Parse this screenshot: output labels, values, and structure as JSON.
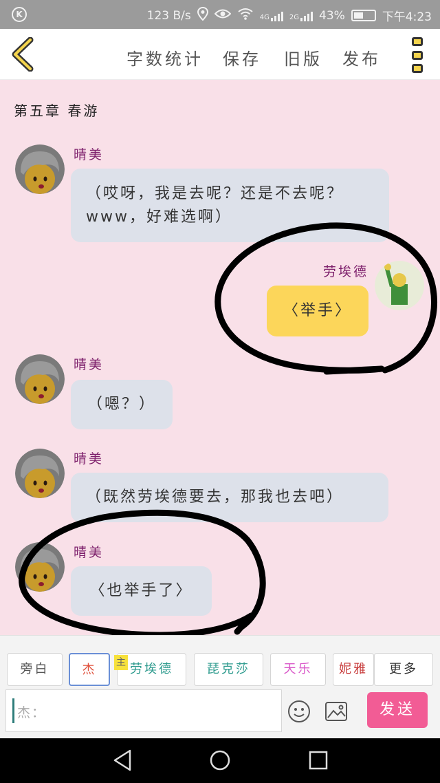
{
  "status_bar": {
    "speed": "123 B/s",
    "network1": "4G",
    "network2": "2G",
    "battery": "43%",
    "time": "下午4:23"
  },
  "header": {
    "menu": [
      "字数统计",
      "保存",
      "旧版",
      "发布"
    ],
    "back_icon": "chevron-left-icon",
    "more_icon": "kebab-menu-icon",
    "accent_color": "#f4d44d"
  },
  "chapter_title": "第五章 春游",
  "messages": [
    {
      "speaker": "晴美",
      "lines": [
        "（哎呀，我是去呢？还是不去呢？",
        "www，好难选啊）"
      ],
      "side": "left"
    },
    {
      "speaker": "劳埃德",
      "lines": [
        "〈举手〉"
      ],
      "side": "right"
    },
    {
      "speaker": "晴美",
      "lines": [
        "（嗯？）"
      ],
      "side": "left"
    },
    {
      "speaker": "晴美",
      "lines": [
        "（既然劳埃德要去，那我也去吧）"
      ],
      "side": "left"
    },
    {
      "speaker": "晴美",
      "lines": [
        "〈也举手了〉"
      ],
      "side": "left"
    }
  ],
  "roles": [
    {
      "label": "旁白",
      "color": "#555555"
    },
    {
      "label": "杰",
      "color": "#e0503c"
    },
    {
      "label": "劳埃德",
      "color": "#2e9b8e"
    },
    {
      "label": "琵克莎",
      "color": "#2e9b8e"
    },
    {
      "label": "天乐",
      "color": "#d957c8"
    },
    {
      "label": "妮雅",
      "color": "#c73a3a"
    },
    {
      "label": "更多",
      "color": "#333333"
    }
  ],
  "main_badge": "主",
  "input": {
    "value": "杰："
  },
  "send_label": "发送"
}
